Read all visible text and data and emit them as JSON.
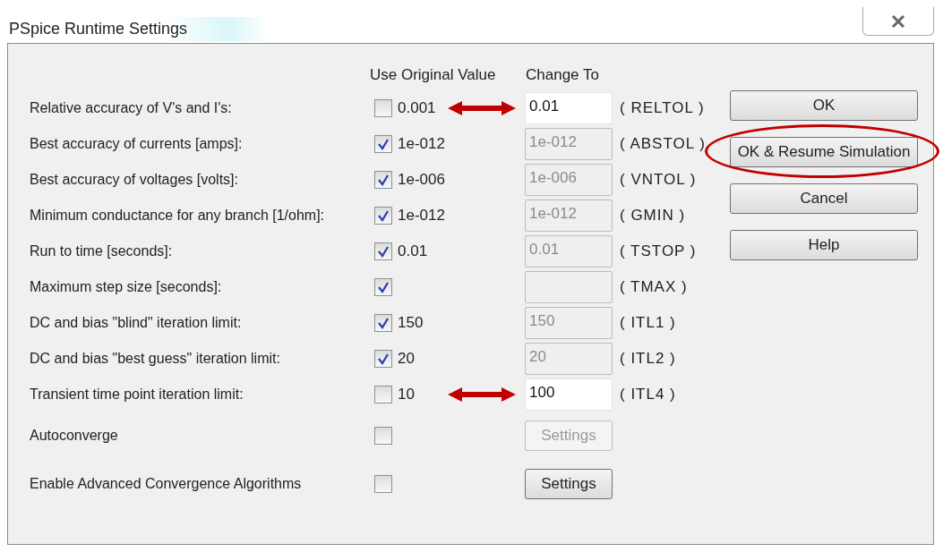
{
  "window": {
    "title": "PSpice Runtime Settings"
  },
  "columns": {
    "use_original": "Use Original Value",
    "change_to": "Change To"
  },
  "rows": [
    {
      "kind": "param",
      "label": "Relative accuracy of V's and I's:",
      "checked": false,
      "original": "0.001",
      "value": "0.01",
      "param": "( RELTOL )",
      "annotated": true
    },
    {
      "kind": "param",
      "label": "Best accuracy of currents [amps]:",
      "checked": true,
      "original": "1e-012",
      "value": "1e-012",
      "param": "( ABSTOL )",
      "annotated": false
    },
    {
      "kind": "param",
      "label": "Best accuracy of voltages [volts]:",
      "checked": true,
      "original": "1e-006",
      "value": "1e-006",
      "param": "( VNTOL )",
      "annotated": false
    },
    {
      "kind": "param",
      "label": "Minimum conductance for any branch [1/ohm]:",
      "checked": true,
      "original": "1e-012",
      "value": "1e-012",
      "param": "( GMIN )",
      "annotated": false
    },
    {
      "kind": "param",
      "label": "Run to time [seconds]:",
      "checked": true,
      "original": "0.01",
      "value": "0.01",
      "param": "( TSTOP )",
      "annotated": false
    },
    {
      "kind": "param",
      "label": "Maximum step size [seconds]:",
      "checked": true,
      "param": "( TMAX )",
      "annotated": false
    },
    {
      "kind": "param",
      "label": "DC and bias \"blind\" iteration limit:",
      "checked": true,
      "original": "150",
      "value": "150",
      "param": "( ITL1 )",
      "annotated": false
    },
    {
      "kind": "param",
      "label": "DC and bias \"best guess\" iteration limit:",
      "checked": true,
      "original": "20",
      "value": "20",
      "param": "( ITL2 )",
      "annotated": false
    },
    {
      "kind": "param",
      "label": "Transient time point iteration limit:",
      "checked": false,
      "original": "10",
      "value": "100",
      "param": "( ITL4 )",
      "annotated": true
    },
    {
      "kind": "option",
      "label": "Autoconverge",
      "checked": false,
      "button": "Settings",
      "disabled": true
    },
    {
      "kind": "option",
      "label": "Enable Advanced Convergence Algorithms",
      "checked": false,
      "button": "Settings",
      "disabled": false
    }
  ],
  "buttons": [
    {
      "label": "OK",
      "highlighted": false
    },
    {
      "label": "OK & Resume Simulation",
      "highlighted": true
    },
    {
      "label": "Cancel",
      "highlighted": false
    },
    {
      "label": "Help",
      "highlighted": false
    }
  ]
}
